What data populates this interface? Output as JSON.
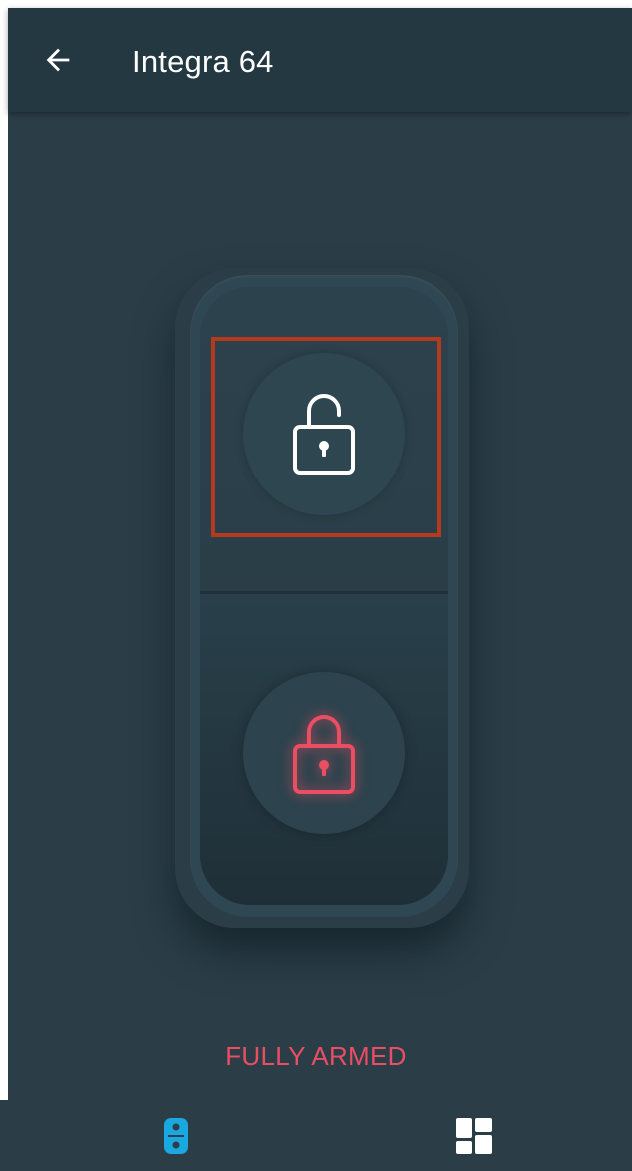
{
  "app_bar": {
    "title": "Integra 64",
    "back_icon": "arrow-left-icon"
  },
  "switch": {
    "top_button": {
      "icon": "lock-open-icon",
      "icon_color": "#ffffff",
      "selected": true
    },
    "bottom_button": {
      "icon": "lock-closed-icon",
      "icon_color": "#e94e63",
      "active": true
    },
    "highlight_color": "#b5391d"
  },
  "status": {
    "text": "FULLY ARMED",
    "color": "#e94e63"
  },
  "bottom_nav": {
    "tabs": [
      {
        "icon": "switch-icon",
        "active": true,
        "color": "#1aa8e0"
      },
      {
        "icon": "dashboard-grid-icon",
        "active": false,
        "color": "#ffffff"
      }
    ]
  }
}
